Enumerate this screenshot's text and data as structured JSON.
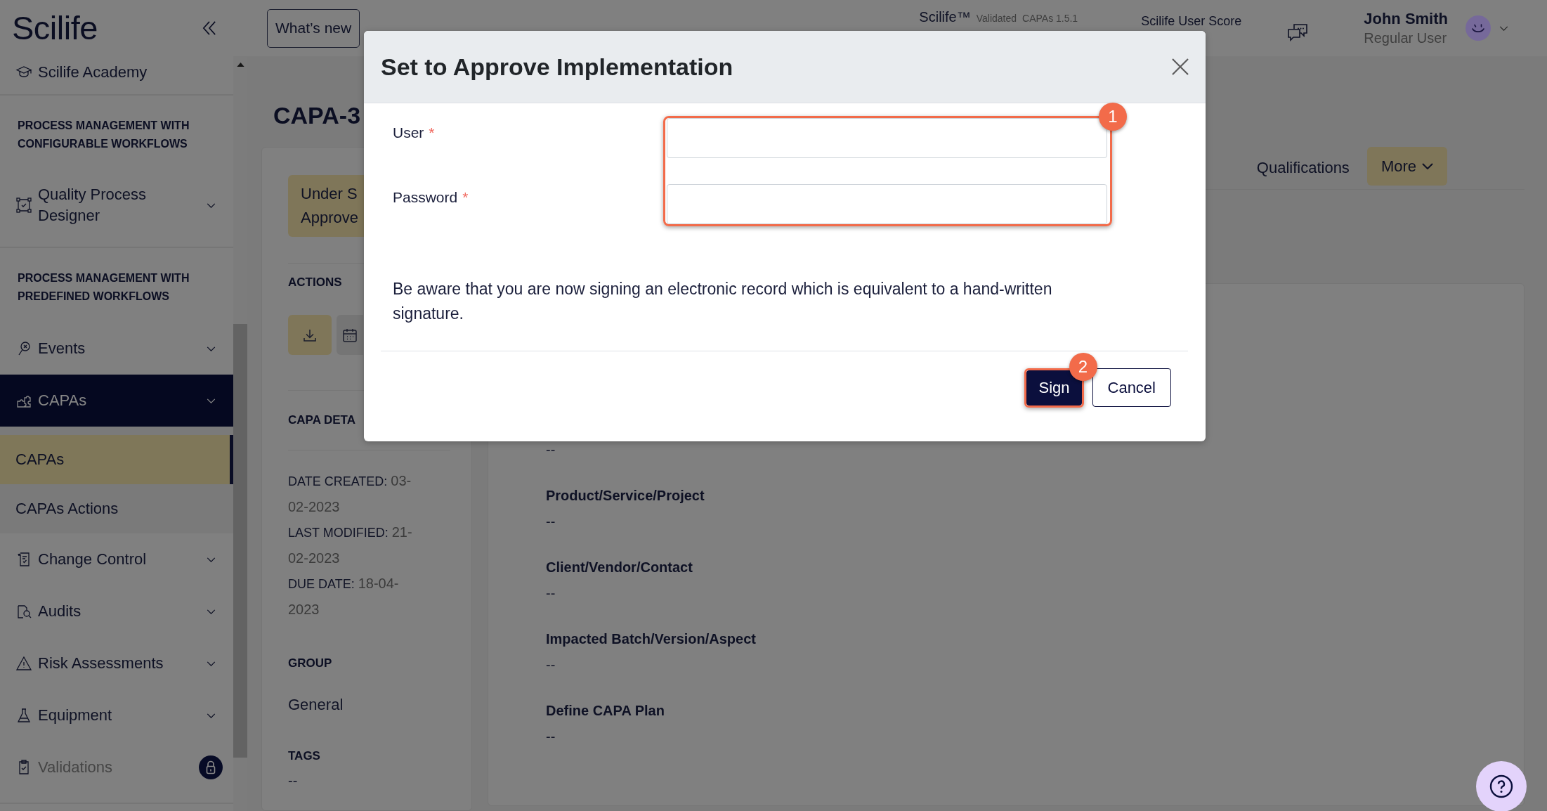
{
  "sidebar": {
    "logo": "Scilife",
    "entries": [
      {
        "kind": "link",
        "label": "Scilife Academy"
      },
      {
        "kind": "heading",
        "label": "PROCESS MANAGEMENT WITH CONFIGURABLE WORKFLOWS"
      },
      {
        "kind": "menu",
        "label": "Quality Process Designer",
        "expanded": false,
        "locked": false
      },
      {
        "kind": "heading",
        "label": "PROCESS MANAGEMENT WITH PREDEFINED WORKFLOWS"
      },
      {
        "kind": "menu",
        "label": "Events",
        "expanded": false,
        "locked": false
      },
      {
        "kind": "menu",
        "label": "CAPAs",
        "expanded": true,
        "locked": false,
        "children": [
          {
            "label": "CAPAs",
            "selected": true
          },
          {
            "label": "CAPAs Actions",
            "selected": false
          }
        ]
      },
      {
        "kind": "menu",
        "label": "Change Control",
        "expanded": false,
        "locked": false
      },
      {
        "kind": "menu",
        "label": "Audits",
        "expanded": false,
        "locked": false
      },
      {
        "kind": "menu",
        "label": "Risk Assessments",
        "expanded": false,
        "locked": false
      },
      {
        "kind": "menu",
        "label": "Equipment",
        "expanded": false,
        "locked": false
      },
      {
        "kind": "menu",
        "label": "Validations",
        "expanded": false,
        "locked": true
      }
    ]
  },
  "topbar": {
    "whats_new": "What’s new",
    "product": "Scilife™",
    "edition": "Validated",
    "version": "CAPAs 1.5.1",
    "score_label": "Scilife User Score",
    "user_name": "John Smith",
    "user_role": "Regular User"
  },
  "record": {
    "title": "CAPA-3",
    "status_lines": [
      "Under S",
      "Approve"
    ],
    "actions_heading": "ACTIONS",
    "details_heading": "CAPA DETA",
    "dates": [
      {
        "label": "DATE CREATED:",
        "value": "03-02-2023"
      },
      {
        "label": "LAST MODIFIED:",
        "value": "21-02-2023"
      },
      {
        "label": "DUE DATE:",
        "value": "18-04-2023"
      }
    ],
    "group_heading": "GROUP",
    "group": "General",
    "tags_heading": "TAGS",
    "tags": "--"
  },
  "tabs": [
    {
      "label": "Qualifications",
      "selected": false
    }
  ],
  "more_label": "More",
  "fields": [
    {
      "value": "--"
    },
    {
      "label": "Product/Service/Project",
      "value": "--"
    },
    {
      "label": "Client/Vendor/Contact",
      "value": "--"
    },
    {
      "label": "Impacted Batch/Version/Aspect",
      "value": "--"
    },
    {
      "label": "Define CAPA Plan",
      "value": "--"
    }
  ],
  "dialog": {
    "title": "Set to Approve Implementation",
    "fields": [
      {
        "label": "User",
        "required_mark": "*"
      },
      {
        "label": "Password",
        "required_mark": "*"
      }
    ],
    "fields_callout": "1",
    "notice": "Be aware that you are now signing an electronic record which is equivalent to a hand-written signature.",
    "buttons": [
      {
        "kind": "submit",
        "label": "Sign",
        "callout": "2"
      },
      {
        "kind": "cancel",
        "label": "Cancel"
      }
    ]
  }
}
